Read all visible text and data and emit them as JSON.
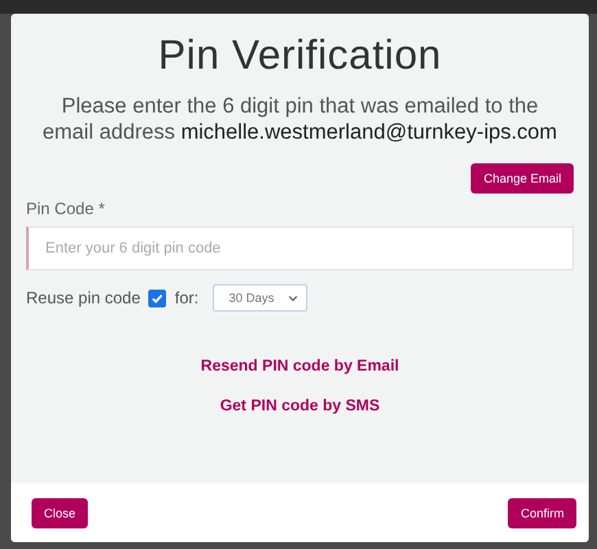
{
  "dialog": {
    "title": "Pin Verification",
    "message": "Please enter the 6 digit pin that was emailed to the email address **michelle.westmerland@turnkey-ips.com**",
    "change_email_button": "Change Email",
    "pin_field": {
      "label": "Pin Code *",
      "placeholder": "Enter your 6 digit pin code"
    },
    "reuse": {
      "label": "Reuse pin code",
      "checked": true,
      "for_label": "for:",
      "duration": "30 Days"
    },
    "links": [
      "Resend PIN code by Email",
      "Get PIN code by SMS"
    ],
    "footer_buttons": [
      "Close",
      "Confirm"
    ]
  }
}
